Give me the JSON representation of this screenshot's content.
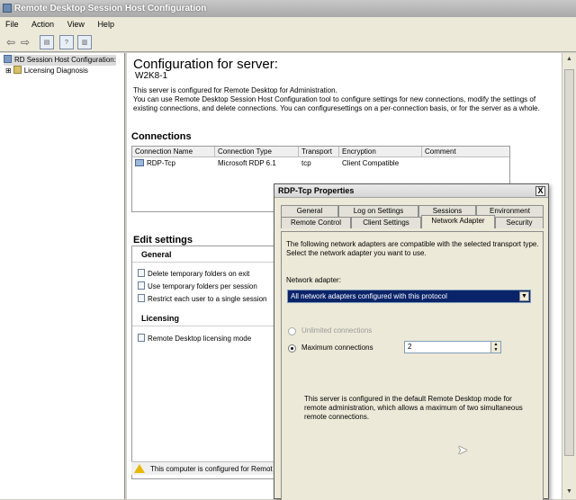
{
  "window": {
    "title": "Remote Desktop Session Host Configuration"
  },
  "menu": [
    "File",
    "Action",
    "View",
    "Help"
  ],
  "tree": {
    "items": [
      {
        "label": "RD Session Host Configuration:",
        "expander": ""
      },
      {
        "label": "Licensing Diagnosis",
        "expander": "⊞"
      }
    ]
  },
  "main": {
    "heading": "Configuration for server:",
    "server": "W2K8-1",
    "description": "This server is configured for Remote Desktop for Administration.\nYou can use Remote Desktop Session Host Configuration tool to configure settings for new connections, modify the settings of existing connections, and delete connections. You can configuresettings on a per-connection basis, or for the server as a whole.",
    "connections": {
      "title": "Connections",
      "columns": [
        "Connection Name",
        "Connection Type",
        "Transport",
        "Encryption",
        "Comment"
      ],
      "rows": [
        {
          "name": "RDP-Tcp",
          "type": "Microsoft RDP 6.1",
          "transport": "tcp",
          "encryption": "Client Compatible",
          "comment": ""
        }
      ]
    },
    "edit_settings": {
      "title": "Edit settings",
      "general_title": "General",
      "general_items": [
        "Delete temporary folders on exit",
        "Use temporary folders per session",
        "Restrict each user to a single session"
      ],
      "licensing_title": "Licensing",
      "licensing_items": [
        "Remote Desktop licensing mode"
      ]
    },
    "status_text": "This computer is configured for Remot"
  },
  "dialog": {
    "title": "RDP-Tcp Properties",
    "close": "X",
    "tabs_back": [
      "General",
      "Log on Settings",
      "Sessions",
      "Environment"
    ],
    "tabs_front": [
      "Remote Control",
      "Client Settings",
      "Network Adapter",
      "Security"
    ],
    "active_tab": "Network Adapter",
    "intro": "The following network adapters are compatible with the selected transport type. Select the network adapter you want to use.",
    "adapter_label": "Network adapter:",
    "adapter_value": "All network adapters configured with this protocol",
    "radio_unlimited": "Unlimited connections",
    "radio_maximum": "Maximum connections",
    "max_value": "2",
    "note": "This server is configured in the default Remote Desktop mode for remote administration, which allows a maximum of two simultaneous remote connections."
  },
  "icons": {
    "back": "back-arrow-icon",
    "forward": "forward-arrow-icon",
    "warning": "warning-icon"
  }
}
